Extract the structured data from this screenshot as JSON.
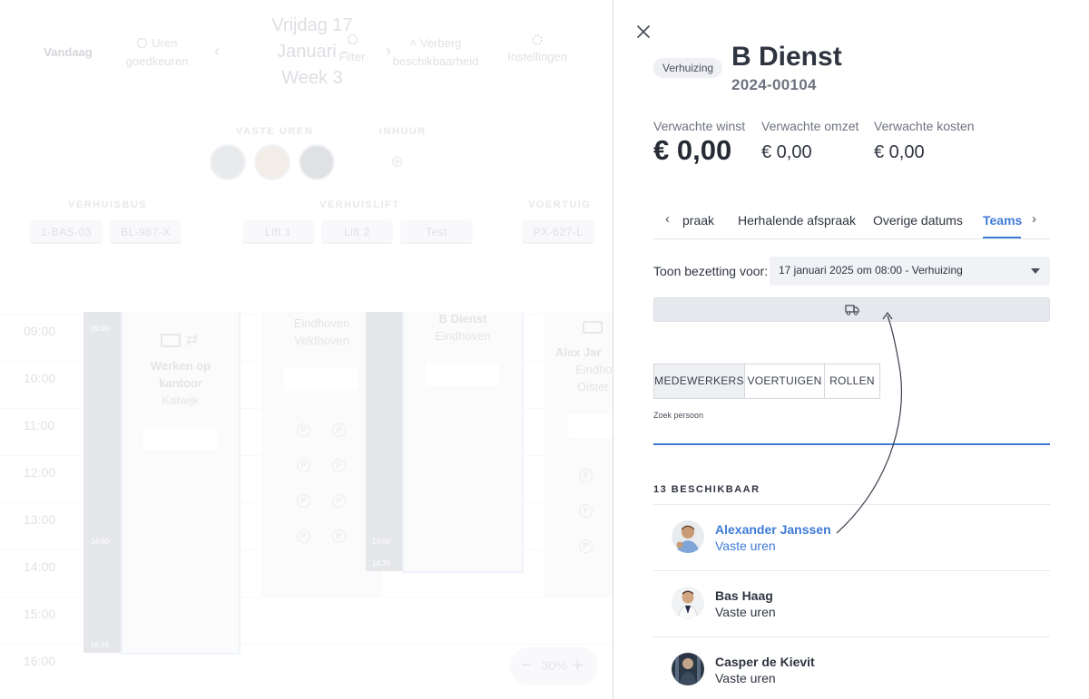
{
  "planner": {
    "today": "Vandaag",
    "approve_hours": "Uren goedkeuren",
    "date_title": "Vrijdag 17 Januari - Week 3",
    "filter": "Filter",
    "hide_availability": "Verberg beschikbaarheid",
    "settings": "Instellingen",
    "section_fixed": "VASTE UREN",
    "section_hire": "INHUUR",
    "section_bus": "VERHUISBUS",
    "section_lift": "VERHUISLIFT",
    "section_vehicle": "VOERTUIG",
    "chips": [
      "1-BAS-03",
      "BL-987-X",
      "Lift 1",
      "Lift 2",
      "Test",
      "PX-627-L"
    ],
    "times": [
      "09:00",
      "10:00",
      "11:00",
      "12:00",
      "13:00",
      "14:00",
      "15:00",
      "16:00"
    ],
    "cards": {
      "office_title": "Werken op kantoor",
      "office_place": "Katwijk",
      "card2_line1": "Eindhoven",
      "card2_line2": "Veldhoven",
      "card3_title": "B Dienst",
      "card3_place": "Eindhoven",
      "card4_title": "Alex Jar",
      "card4_line1": "Eindho",
      "card4_line2": "Oister"
    },
    "small_times": [
      "09:00",
      "14:00",
      "16:15",
      "14:00",
      "14:30"
    ],
    "zoom": "30%"
  },
  "panel": {
    "badge": "Verhuizing",
    "title": "B Dienst",
    "number": "2024-00104",
    "metrics": {
      "profit_label": "Verwachte winst",
      "profit_value": "€ 0,00",
      "revenue_label": "Verwachte omzet",
      "revenue_value": "€ 0,00",
      "cost_label": "Verwachte kosten",
      "cost_value": "€ 0,00"
    },
    "tabs": [
      "praak",
      "Herhalende afspraak",
      "Overige datums",
      "Teams"
    ],
    "active_tab": "Teams",
    "show_label": "Toon bezetting voor:",
    "show_value": "17 januari 2025 om 08:00 - Verhuizing",
    "segments": [
      "MEDEWERKERS",
      "VOERTUIGEN",
      "ROLLEN"
    ],
    "search_label": "Zoek persoon",
    "search_placeholder": "",
    "available_heading": "13 BESCHIKBAAR",
    "people": [
      {
        "name": "Alexander Janssen",
        "type": "Vaste uren"
      },
      {
        "name": "Bas Haag",
        "type": "Vaste uren"
      },
      {
        "name": "Casper de Kievit",
        "type": "Vaste uren"
      }
    ]
  },
  "colors": {
    "accent": "#3f7bd6",
    "text": "#2f3441"
  }
}
